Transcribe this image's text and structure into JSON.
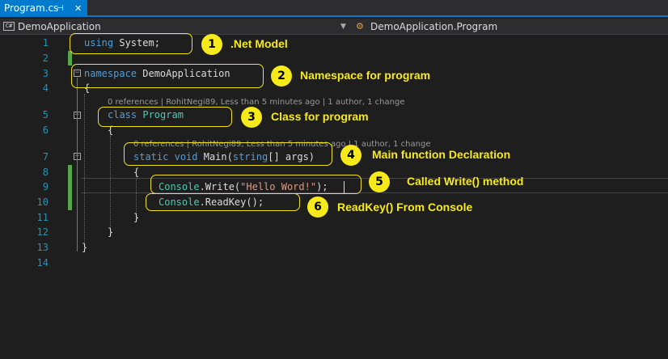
{
  "tab": {
    "title": "Program.cs",
    "pin_glyph": "⊣",
    "close_glyph": "✕"
  },
  "navbar": {
    "left_icon": "C#",
    "project": "DemoApplication",
    "right_icon": "class-icon",
    "scope": "DemoApplication.Program"
  },
  "editor": {
    "line_numbers": [
      "1",
      "2",
      "3",
      "4",
      "5",
      "6",
      "7",
      "8",
      "9",
      "10",
      "11",
      "12",
      "13",
      "14"
    ],
    "lines": {
      "l1": {
        "kw": "using",
        "rest": " System;"
      },
      "l3": {
        "kw": "namespace",
        "rest": " DemoApplication"
      },
      "l4": "{",
      "l5": {
        "kw": "class",
        "type": "Program"
      },
      "l6": "{",
      "l7": {
        "kw1": "static",
        "kw2": "void",
        "name": " Main(",
        "kw3": "string",
        "rest": "[] args)"
      },
      "l8": "{",
      "l9": {
        "type": "Console",
        "method": ".Write(",
        "str": "\"Hello Word!\"",
        "rest": ");"
      },
      "l10": {
        "type": "Console",
        "rest": ".ReadKey();"
      },
      "l11": "}",
      "l12": "}",
      "l13": "}"
    },
    "codelens_class": "0 references | RohitNegi89, Less than 5 minutes ago | 1 author, 1 change",
    "codelens_main": "0 references | RohitNegi89, Less than 5 minutes ago | 1 author, 1 change"
  },
  "annotations": [
    {
      "n": "1",
      "label": ".Net Model"
    },
    {
      "n": "2",
      "label": "Namespace for program"
    },
    {
      "n": "3",
      "label": "Class for program"
    },
    {
      "n": "4",
      "label": "Main function Declaration"
    },
    {
      "n": "5",
      "label": "Called Write() method"
    },
    {
      "n": "6",
      "label": "ReadKey() From Console"
    }
  ],
  "colors": {
    "accent": "#007acc",
    "annotation": "#f7ea1b",
    "keyword": "#569cd6",
    "type": "#4ec9b0",
    "string": "#d69d85",
    "line_number": "#2b91af"
  }
}
